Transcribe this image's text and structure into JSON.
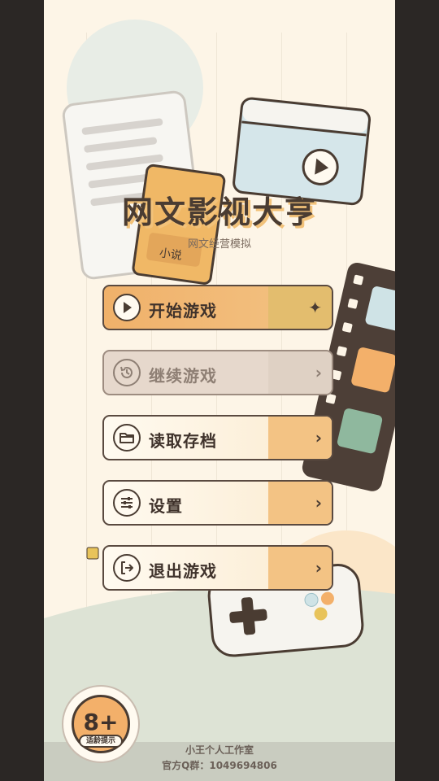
{
  "game": {
    "title": "网文影视大亨",
    "subtitle": "网文经营模拟",
    "novel_card_label": "小说"
  },
  "menu": {
    "start": {
      "label": "开始游戏",
      "icon": "play-icon",
      "trail_icon": "sparkle-icon"
    },
    "continue": {
      "label": "继续游戏",
      "icon": "history-icon",
      "state": "disabled"
    },
    "load": {
      "label": "读取存档",
      "icon": "folder-icon"
    },
    "settings": {
      "label": "设置",
      "icon": "sliders-icon"
    },
    "quit": {
      "label": "退出游戏",
      "icon": "exit-icon"
    },
    "arrow_glyph": "›",
    "sparkle_glyph": "✦"
  },
  "age_rating": {
    "value": "8+",
    "label": "适龄提示"
  },
  "footer": {
    "studio": "小王个人工作室",
    "qq_group": "官方Q群：1049694806"
  },
  "colors": {
    "background": "#fdf5e7",
    "accent": "#f3b06a",
    "text": "#3f322b",
    "disabled": "#e6d8cc"
  }
}
